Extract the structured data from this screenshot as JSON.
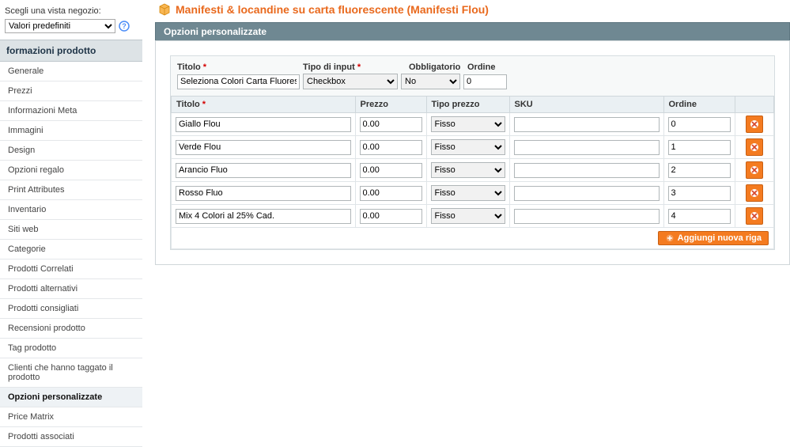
{
  "store_scope": {
    "label": "Scegli una vista negozio:",
    "value": "Valori predefiniti"
  },
  "sidebar": {
    "section_title": "formazioni prodotto",
    "items": [
      {
        "label": "Generale",
        "active": false
      },
      {
        "label": "Prezzi",
        "active": false
      },
      {
        "label": "Informazioni Meta",
        "active": false
      },
      {
        "label": "Immagini",
        "active": false
      },
      {
        "label": "Design",
        "active": false
      },
      {
        "label": "Opzioni regalo",
        "active": false
      },
      {
        "label": "Print Attributes",
        "active": false
      },
      {
        "label": "Inventario",
        "active": false
      },
      {
        "label": "Siti web",
        "active": false
      },
      {
        "label": "Categorie",
        "active": false
      },
      {
        "label": "Prodotti Correlati",
        "active": false
      },
      {
        "label": "Prodotti alternativi",
        "active": false
      },
      {
        "label": "Prodotti consigliati",
        "active": false
      },
      {
        "label": "Recensioni prodotto",
        "active": false
      },
      {
        "label": "Tag prodotto",
        "active": false
      },
      {
        "label": "Clienti che hanno taggato il prodotto",
        "active": false
      },
      {
        "label": "Opzioni personalizzate",
        "active": true
      },
      {
        "label": "Price Matrix",
        "active": false
      },
      {
        "label": "Prodotti associati",
        "active": false
      }
    ]
  },
  "page": {
    "title": "Manifesti & locandine su carta fluorescente (Manifesti Flou)",
    "panel_title": "Opzioni personalizzate"
  },
  "option": {
    "labels": {
      "title": "Titolo",
      "input_type": "Tipo di input",
      "required": "Obbligatorio",
      "sort_order": "Ordine"
    },
    "values": {
      "title": "Seleziona Colori Carta Fluorescente",
      "input_type": "Checkbox",
      "required": "No",
      "sort_order": "0"
    },
    "row_labels": {
      "title": "Titolo",
      "price": "Prezzo",
      "price_type": "Tipo prezzo",
      "sku": "SKU",
      "sort_order": "Ordine"
    },
    "price_type_options": [
      "Fisso"
    ],
    "rows": [
      {
        "title": "Giallo Flou",
        "price": "0.00",
        "price_type": "Fisso",
        "sku": "",
        "sort_order": "0"
      },
      {
        "title": "Verde Flou",
        "price": "0.00",
        "price_type": "Fisso",
        "sku": "",
        "sort_order": "1"
      },
      {
        "title": "Arancio Fluo",
        "price": "0.00",
        "price_type": "Fisso",
        "sku": "",
        "sort_order": "2"
      },
      {
        "title": "Rosso Fluo",
        "price": "0.00",
        "price_type": "Fisso",
        "sku": "",
        "sort_order": "3"
      },
      {
        "title": "Mix 4 Colori al 25% Cad.",
        "price": "0.00",
        "price_type": "Fisso",
        "sku": "",
        "sort_order": "4"
      }
    ],
    "add_row_label": "Aggiungi nuova riga"
  }
}
